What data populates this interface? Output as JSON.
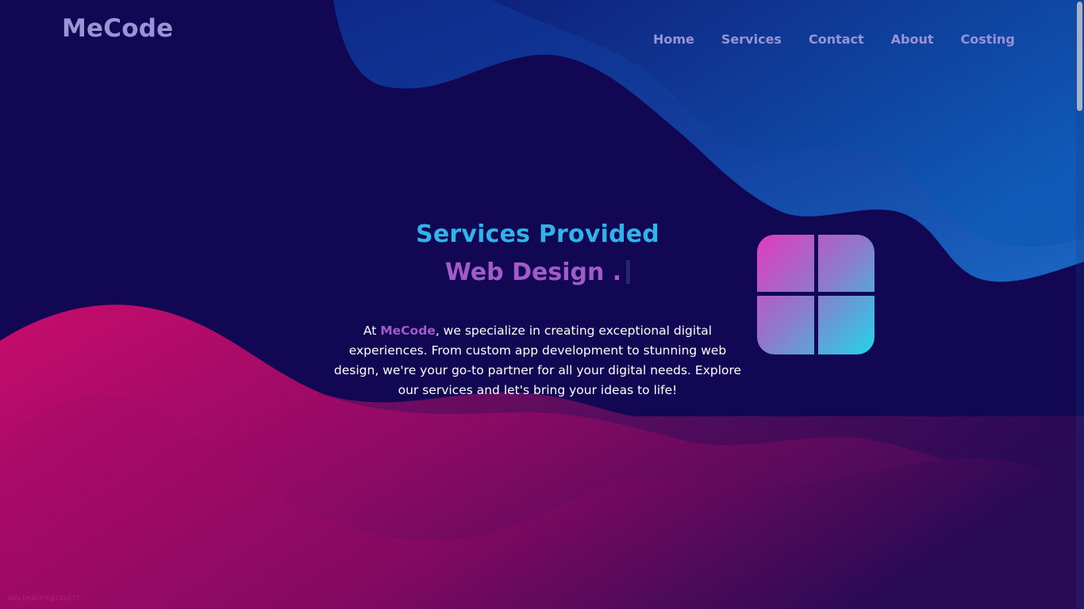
{
  "header": {
    "logo": "MeCode",
    "nav": [
      "Home",
      "Services",
      "Contact",
      "About",
      "Costing"
    ]
  },
  "hero": {
    "title": "Services Provided",
    "typed_text": "Web Design .",
    "description_prefix": "At ",
    "brand": "MeCode",
    "description_suffix": ", we specialize in creating exceptional digital experiences. From custom app development to stunning web design, we're your go-to partner for all your digital needs. Explore our services and let's bring your ideas to life!"
  },
  "watermark": "WALLHAVEN@LEKETT",
  "icons": {
    "hero_tile": "windows-logo-icon"
  },
  "colors": {
    "background": "#110753",
    "accent_blue": "#2fb3e8",
    "accent_purple": "#a25bc8",
    "nav_text": "#9a93d6",
    "wave_pink": "#c4106a",
    "wave_blue": "#1560b8"
  }
}
